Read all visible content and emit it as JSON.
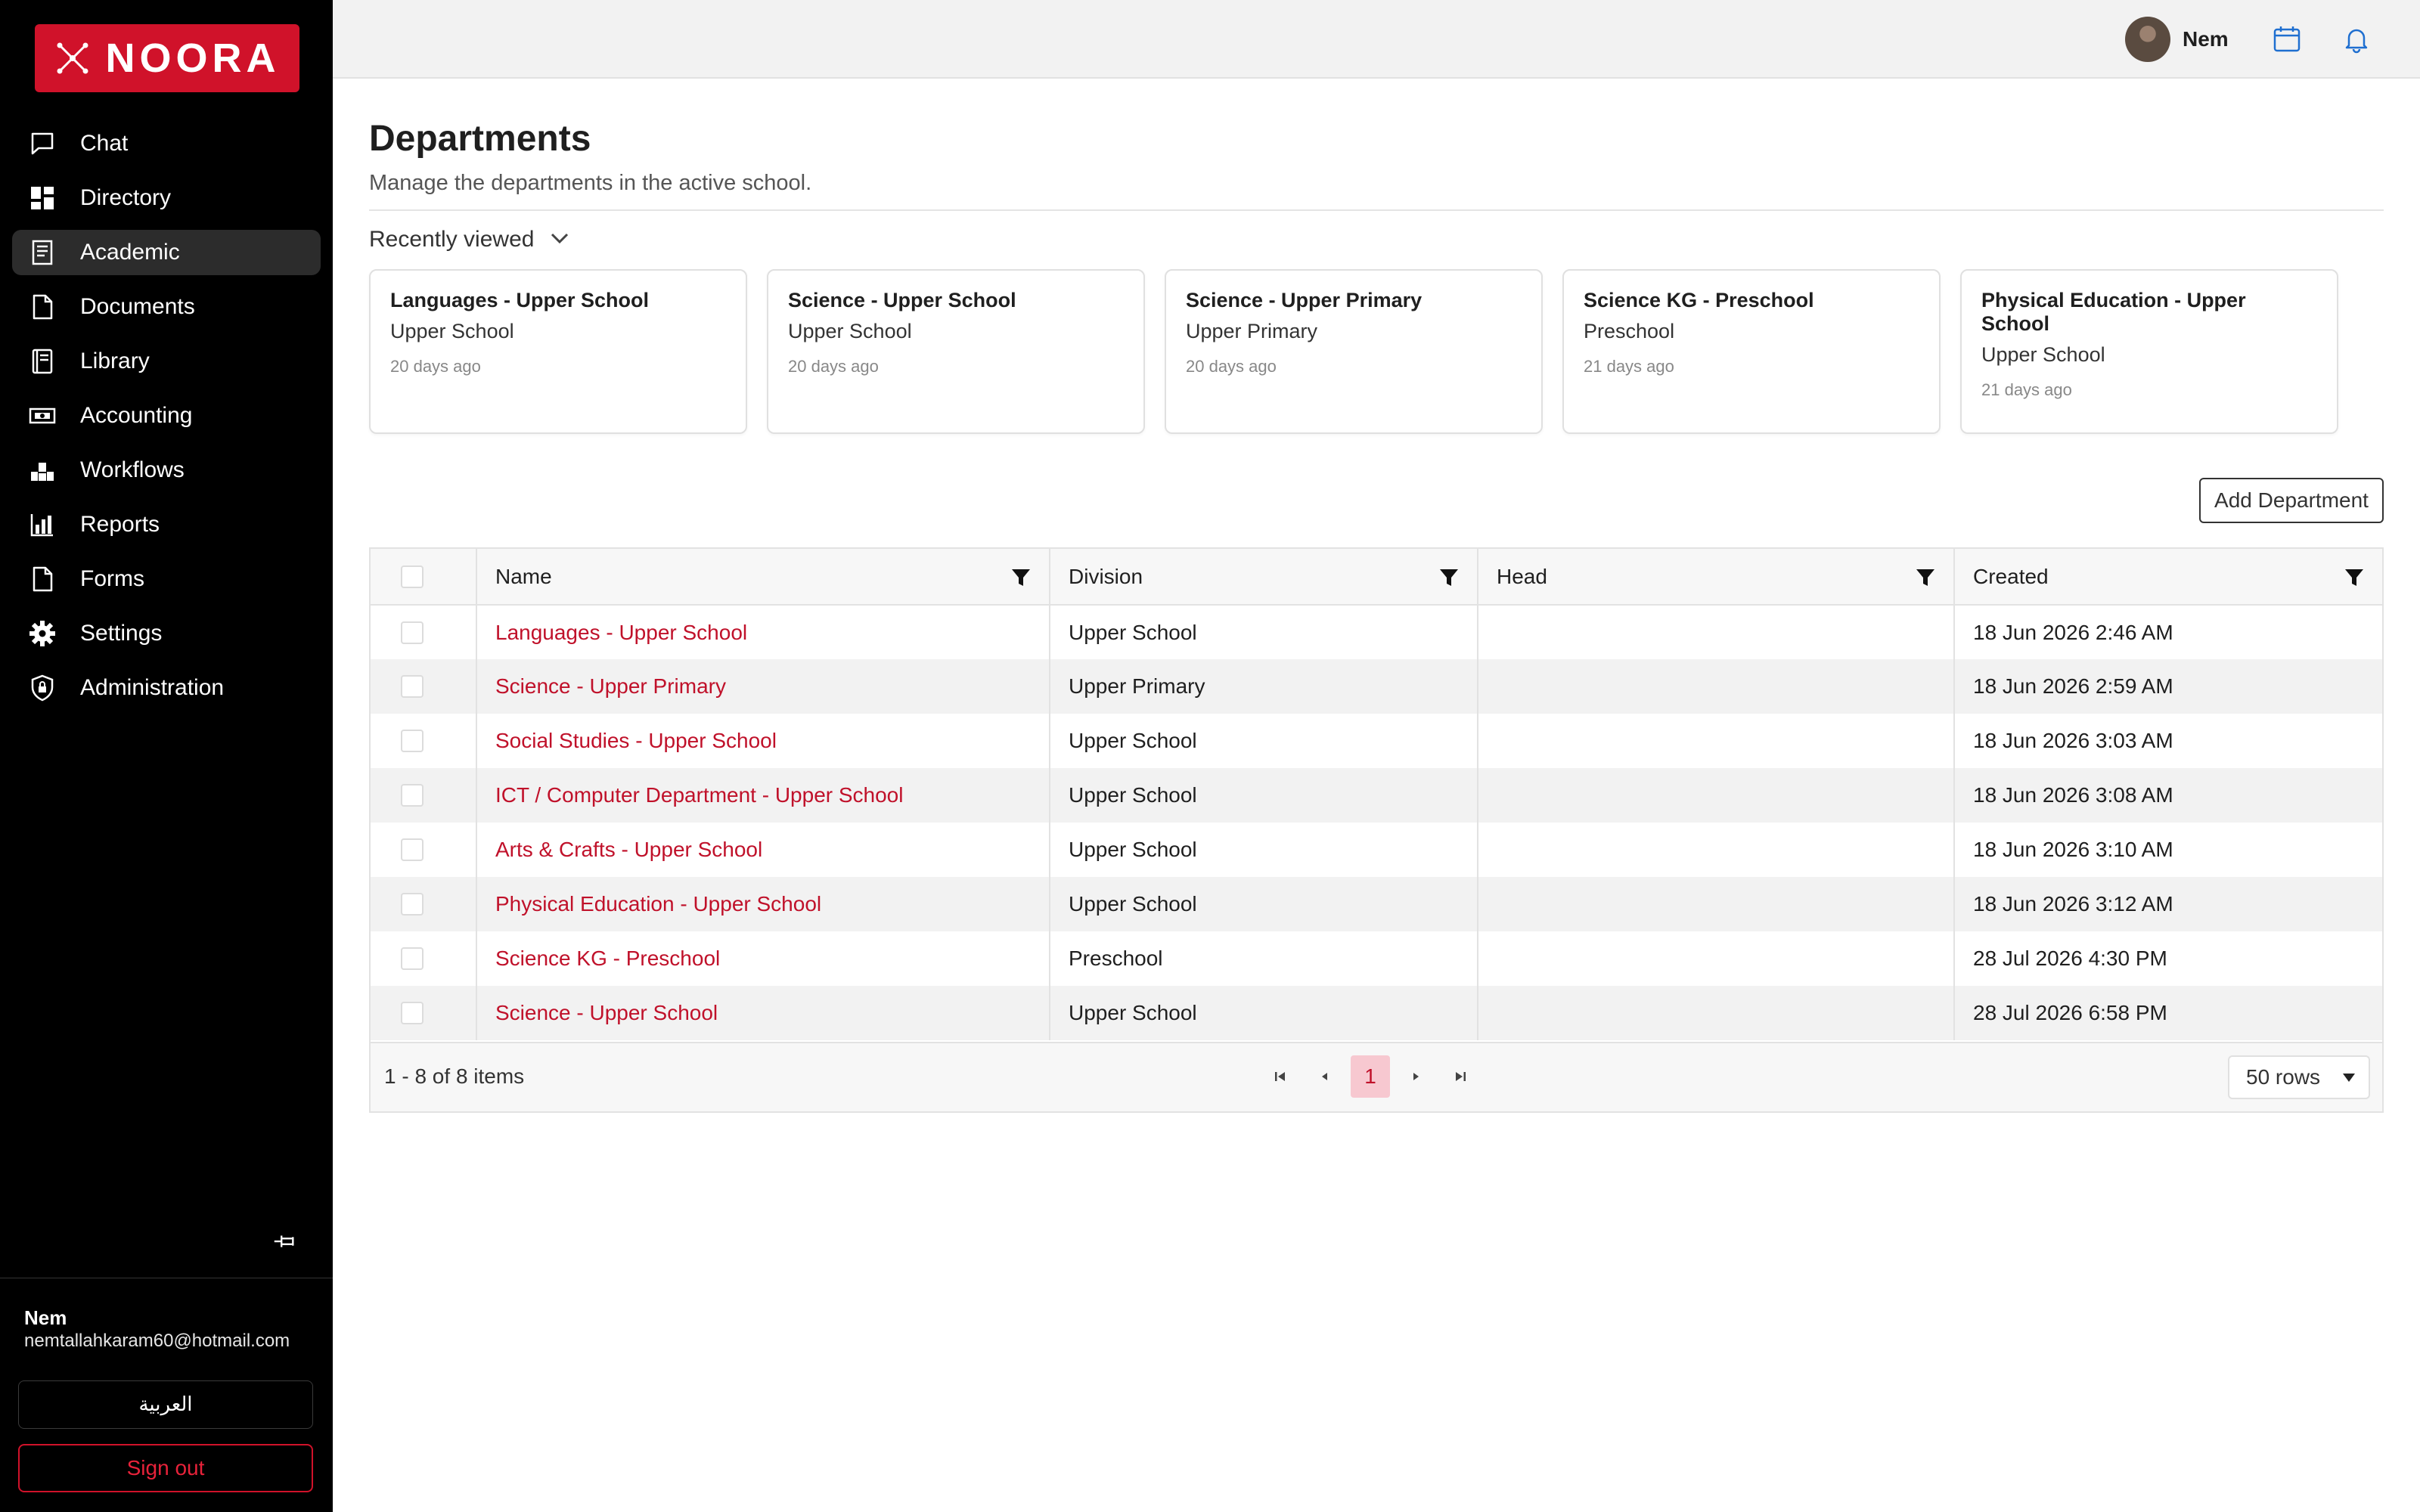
{
  "app": {
    "brand": "NOORA",
    "brand_color": "#d0122a"
  },
  "sidebar": {
    "items": [
      {
        "label": "Chat",
        "icon": "chat-icon"
      },
      {
        "label": "Directory",
        "icon": "grid-icon"
      },
      {
        "label": "Academic",
        "icon": "book-icon",
        "active": true
      },
      {
        "label": "Documents",
        "icon": "document-icon"
      },
      {
        "label": "Library",
        "icon": "library-icon"
      },
      {
        "label": "Accounting",
        "icon": "money-icon"
      },
      {
        "label": "Workflows",
        "icon": "workflow-icon"
      },
      {
        "label": "Reports",
        "icon": "chart-icon"
      },
      {
        "label": "Forms",
        "icon": "form-icon"
      },
      {
        "label": "Settings",
        "icon": "gear-icon"
      },
      {
        "label": "Administration",
        "icon": "shield-lock-icon"
      }
    ],
    "user_name": "Nem",
    "user_email": "nemtallahkaram60@hotmail.com",
    "language_button": "العربية",
    "signout_button": "Sign out"
  },
  "topbar": {
    "user_name": "Nem"
  },
  "page": {
    "title": "Departments",
    "subtitle": "Manage the departments in the active school.",
    "recent_label": "Recently viewed",
    "add_button": "Add Department"
  },
  "recent": [
    {
      "title": "Languages - Upper School",
      "division": "Upper School",
      "time": "20 days ago"
    },
    {
      "title": "Science - Upper School",
      "division": "Upper School",
      "time": "20 days ago"
    },
    {
      "title": "Science - Upper Primary",
      "division": "Upper Primary",
      "time": "20 days ago"
    },
    {
      "title": "Science KG - Preschool",
      "division": "Preschool",
      "time": "21 days ago"
    },
    {
      "title": "Physical Education - Upper School",
      "division": "Upper School",
      "time": "21 days ago"
    }
  ],
  "table": {
    "columns": [
      "Name",
      "Division",
      "Head",
      "Created"
    ],
    "rows": [
      {
        "name": "Languages - Upper School",
        "division": "Upper School",
        "head": "",
        "created": "18 Jun 2026 2:46 AM"
      },
      {
        "name": "Science - Upper Primary",
        "division": "Upper Primary",
        "head": "",
        "created": "18 Jun 2026 2:59 AM"
      },
      {
        "name": "Social Studies - Upper School",
        "division": "Upper School",
        "head": "",
        "created": "18 Jun 2026 3:03 AM"
      },
      {
        "name": "ICT / Computer Department - Upper School",
        "division": "Upper School",
        "head": "",
        "created": "18 Jun 2026 3:08 AM"
      },
      {
        "name": "Arts & Crafts - Upper School",
        "division": "Upper School",
        "head": "",
        "created": "18 Jun 2026 3:10 AM"
      },
      {
        "name": "Physical Education - Upper School",
        "division": "Upper School",
        "head": "",
        "created": "18 Jun 2026 3:12 AM"
      },
      {
        "name": "Science KG - Preschool",
        "division": "Preschool",
        "head": "",
        "created": "28 Jul 2026 4:30 PM"
      },
      {
        "name": "Science - Upper School",
        "division": "Upper School",
        "head": "",
        "created": "28 Jul 2026 6:58 PM"
      }
    ],
    "items_count": "1 - 8 of 8 items",
    "current_page": "1",
    "rows_per_page": "50 rows"
  }
}
